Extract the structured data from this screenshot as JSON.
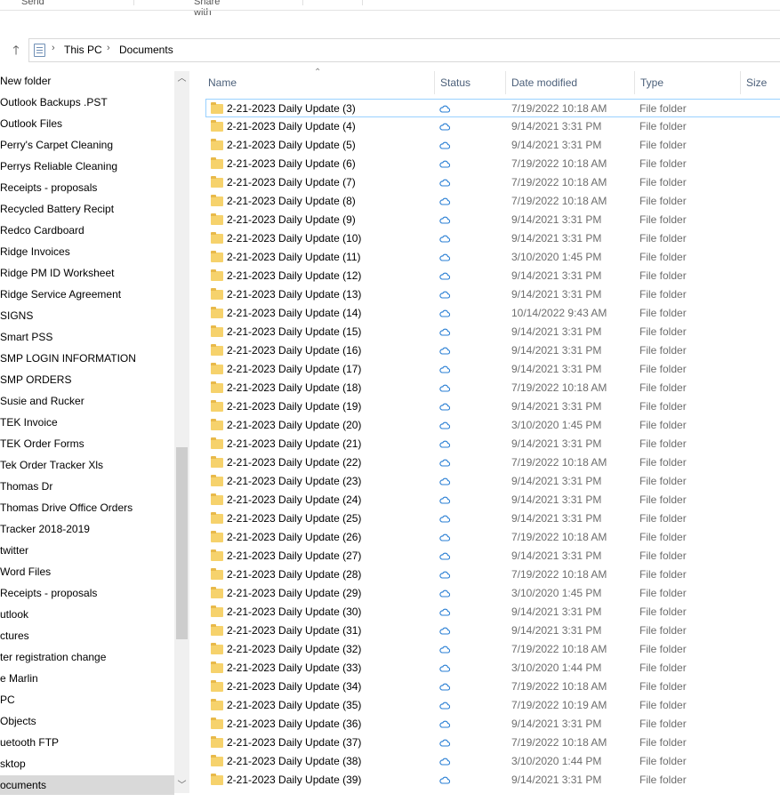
{
  "ribbon": {
    "send_label": "Send",
    "share_label": "Share with"
  },
  "address": {
    "crumbs": [
      "This PC",
      "Documents"
    ]
  },
  "nav": {
    "items": [
      "New folder",
      "Outlook Backups .PST",
      "Outlook Files",
      "Perry's Carpet Cleaning",
      "Perrys Reliable Cleaning",
      "Receipts - proposals",
      "Recycled Battery Recipt",
      "Redco Cardboard",
      "Ridge Invoices",
      "Ridge PM ID Worksheet",
      "Ridge Service Agreement",
      "SIGNS",
      "Smart PSS",
      "SMP LOGIN INFORMATION",
      "SMP ORDERS",
      "Susie and Rucker",
      "TEK Invoice",
      "TEK Order Forms",
      "Tek Order Tracker Xls",
      "Thomas Dr",
      "Thomas Drive Office Orders",
      "Tracker 2018-2019",
      "twitter",
      "Word Files",
      "Receipts - proposals",
      "utlook",
      "ctures",
      "ter registration change",
      "e Marlin",
      " PC",
      " Objects",
      "uetooth FTP",
      "sktop",
      "ocuments"
    ],
    "selected_index": 33
  },
  "columns": {
    "name": "Name",
    "status": "Status",
    "date": "Date modified",
    "type": "Type",
    "size": "Size"
  },
  "files": [
    {
      "name": "2-21-2023 Daily Update (3)",
      "date": "7/19/2022 10:18 AM",
      "type": "File folder"
    },
    {
      "name": "2-21-2023 Daily Update (4)",
      "date": "9/14/2021 3:31 PM",
      "type": "File folder"
    },
    {
      "name": "2-21-2023 Daily Update (5)",
      "date": "9/14/2021 3:31 PM",
      "type": "File folder"
    },
    {
      "name": "2-21-2023 Daily Update (6)",
      "date": "7/19/2022 10:18 AM",
      "type": "File folder"
    },
    {
      "name": "2-21-2023 Daily Update (7)",
      "date": "7/19/2022 10:18 AM",
      "type": "File folder"
    },
    {
      "name": "2-21-2023 Daily Update (8)",
      "date": "7/19/2022 10:18 AM",
      "type": "File folder"
    },
    {
      "name": "2-21-2023 Daily Update (9)",
      "date": "9/14/2021 3:31 PM",
      "type": "File folder"
    },
    {
      "name": "2-21-2023 Daily Update (10)",
      "date": "9/14/2021 3:31 PM",
      "type": "File folder"
    },
    {
      "name": "2-21-2023 Daily Update (11)",
      "date": "3/10/2020 1:45 PM",
      "type": "File folder"
    },
    {
      "name": "2-21-2023 Daily Update (12)",
      "date": "9/14/2021 3:31 PM",
      "type": "File folder"
    },
    {
      "name": "2-21-2023 Daily Update (13)",
      "date": "9/14/2021 3:31 PM",
      "type": "File folder"
    },
    {
      "name": "2-21-2023 Daily Update (14)",
      "date": "10/14/2022 9:43 AM",
      "type": "File folder"
    },
    {
      "name": "2-21-2023 Daily Update (15)",
      "date": "9/14/2021 3:31 PM",
      "type": "File folder"
    },
    {
      "name": "2-21-2023 Daily Update (16)",
      "date": "9/14/2021 3:31 PM",
      "type": "File folder"
    },
    {
      "name": "2-21-2023 Daily Update (17)",
      "date": "9/14/2021 3:31 PM",
      "type": "File folder"
    },
    {
      "name": "2-21-2023 Daily Update (18)",
      "date": "7/19/2022 10:18 AM",
      "type": "File folder"
    },
    {
      "name": "2-21-2023 Daily Update (19)",
      "date": "9/14/2021 3:31 PM",
      "type": "File folder"
    },
    {
      "name": "2-21-2023 Daily Update (20)",
      "date": "3/10/2020 1:45 PM",
      "type": "File folder"
    },
    {
      "name": "2-21-2023 Daily Update (21)",
      "date": "9/14/2021 3:31 PM",
      "type": "File folder"
    },
    {
      "name": "2-21-2023 Daily Update (22)",
      "date": "7/19/2022 10:18 AM",
      "type": "File folder"
    },
    {
      "name": "2-21-2023 Daily Update (23)",
      "date": "9/14/2021 3:31 PM",
      "type": "File folder"
    },
    {
      "name": "2-21-2023 Daily Update (24)",
      "date": "9/14/2021 3:31 PM",
      "type": "File folder"
    },
    {
      "name": "2-21-2023 Daily Update (25)",
      "date": "9/14/2021 3:31 PM",
      "type": "File folder"
    },
    {
      "name": "2-21-2023 Daily Update (26)",
      "date": "7/19/2022 10:18 AM",
      "type": "File folder"
    },
    {
      "name": "2-21-2023 Daily Update (27)",
      "date": "9/14/2021 3:31 PM",
      "type": "File folder"
    },
    {
      "name": "2-21-2023 Daily Update (28)",
      "date": "7/19/2022 10:18 AM",
      "type": "File folder"
    },
    {
      "name": "2-21-2023 Daily Update (29)",
      "date": "3/10/2020 1:45 PM",
      "type": "File folder"
    },
    {
      "name": "2-21-2023 Daily Update (30)",
      "date": "9/14/2021 3:31 PM",
      "type": "File folder"
    },
    {
      "name": "2-21-2023 Daily Update (31)",
      "date": "9/14/2021 3:31 PM",
      "type": "File folder"
    },
    {
      "name": "2-21-2023 Daily Update (32)",
      "date": "7/19/2022 10:18 AM",
      "type": "File folder"
    },
    {
      "name": "2-21-2023 Daily Update (33)",
      "date": "3/10/2020 1:44 PM",
      "type": "File folder"
    },
    {
      "name": "2-21-2023 Daily Update (34)",
      "date": "7/19/2022 10:18 AM",
      "type": "File folder"
    },
    {
      "name": "2-21-2023 Daily Update (35)",
      "date": "7/19/2022 10:19 AM",
      "type": "File folder"
    },
    {
      "name": "2-21-2023 Daily Update (36)",
      "date": "9/14/2021 3:31 PM",
      "type": "File folder"
    },
    {
      "name": "2-21-2023 Daily Update (37)",
      "date": "7/19/2022 10:18 AM",
      "type": "File folder"
    },
    {
      "name": "2-21-2023 Daily Update (38)",
      "date": "3/10/2020 1:44 PM",
      "type": "File folder"
    },
    {
      "name": "2-21-2023 Daily Update (39)",
      "date": "9/14/2021 3:31 PM",
      "type": "File folder"
    }
  ],
  "icons": {
    "folder": "folder-icon",
    "status": "cloud-icon"
  },
  "colors": {
    "folder": "#f6d26c",
    "cloud": "#2a7fd4",
    "header_text": "#4c607a",
    "selection": "#d9d9d9"
  }
}
